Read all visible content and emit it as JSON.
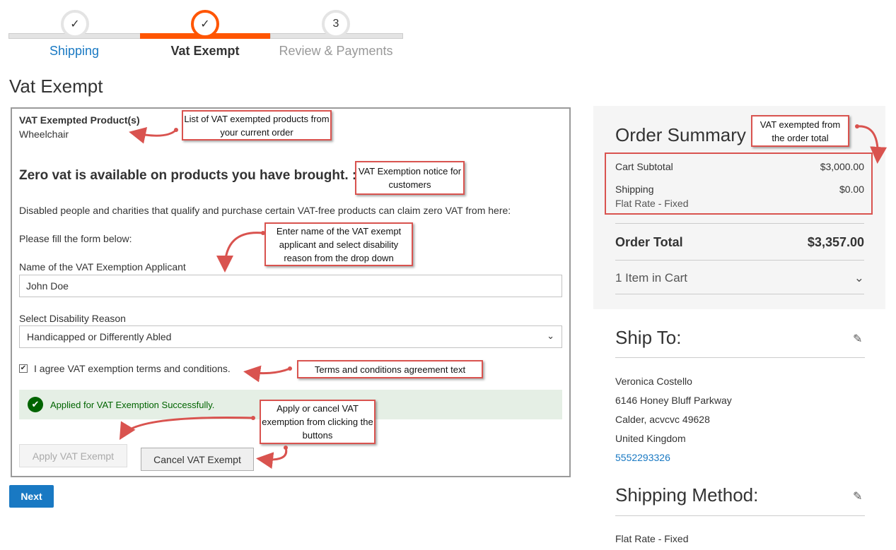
{
  "steps": [
    {
      "label": "Shipping",
      "marker": "✓"
    },
    {
      "label": "Vat Exempt",
      "marker": "✓"
    },
    {
      "label": "Review & Payments",
      "marker": "3"
    }
  ],
  "page_title": "Vat Exempt",
  "form": {
    "products_title": "VAT Exempted Product(s)",
    "product_name": "Wheelchair",
    "notice": "Zero vat is available on products you have brought. :",
    "description": "Disabled people and charities that qualify and purchase certain VAT-free products can claim zero VAT from here:",
    "fill_prompt": "Please fill the form below:",
    "name_label": "Name of the VAT Exemption Applicant",
    "name_value": "John Doe",
    "reason_label": "Select Disability Reason",
    "reason_value": "Handicapped or Differently Abled",
    "agree_text": "I agree VAT exemption terms and conditions.",
    "success_message": "Applied for VAT Exemption Successfully.",
    "apply_button": "Apply VAT Exempt",
    "cancel_button": "Cancel VAT Exempt"
  },
  "next_button": "Next",
  "summary": {
    "title": "Order Summary",
    "subtotal_label": "Cart Subtotal",
    "subtotal_value": "$3,000.00",
    "shipping_label": "Shipping",
    "shipping_value": "$0.00",
    "shipping_method": "Flat Rate - Fixed",
    "total_label": "Order Total",
    "total_value": "$3,357.00",
    "items_in_cart": "1 Item in Cart"
  },
  "ship_to": {
    "title": "Ship To:",
    "name": "Veronica Costello",
    "street": "6146 Honey Bluff Parkway",
    "city": "Calder, acvcvc 49628",
    "country": "United Kingdom",
    "phone": "5552293326"
  },
  "shipping_method": {
    "title": "Shipping Method:",
    "value": "Flat Rate - Fixed"
  },
  "annotations": {
    "products": "List of VAT exempted products from your current order",
    "notice": "VAT Exemption notice for customers",
    "name": "Enter name of the VAT exempt applicant and select disability reason from the drop down",
    "terms": "Terms and conditions agreement text",
    "buttons": "Apply or cancel VAT exemption from clicking the buttons",
    "summary": "VAT exempted from the order total"
  },
  "colors": {
    "accent_orange": "#ff5501",
    "link_blue": "#1979c3",
    "annotation_red": "#d9534f",
    "success_green": "#006400"
  }
}
